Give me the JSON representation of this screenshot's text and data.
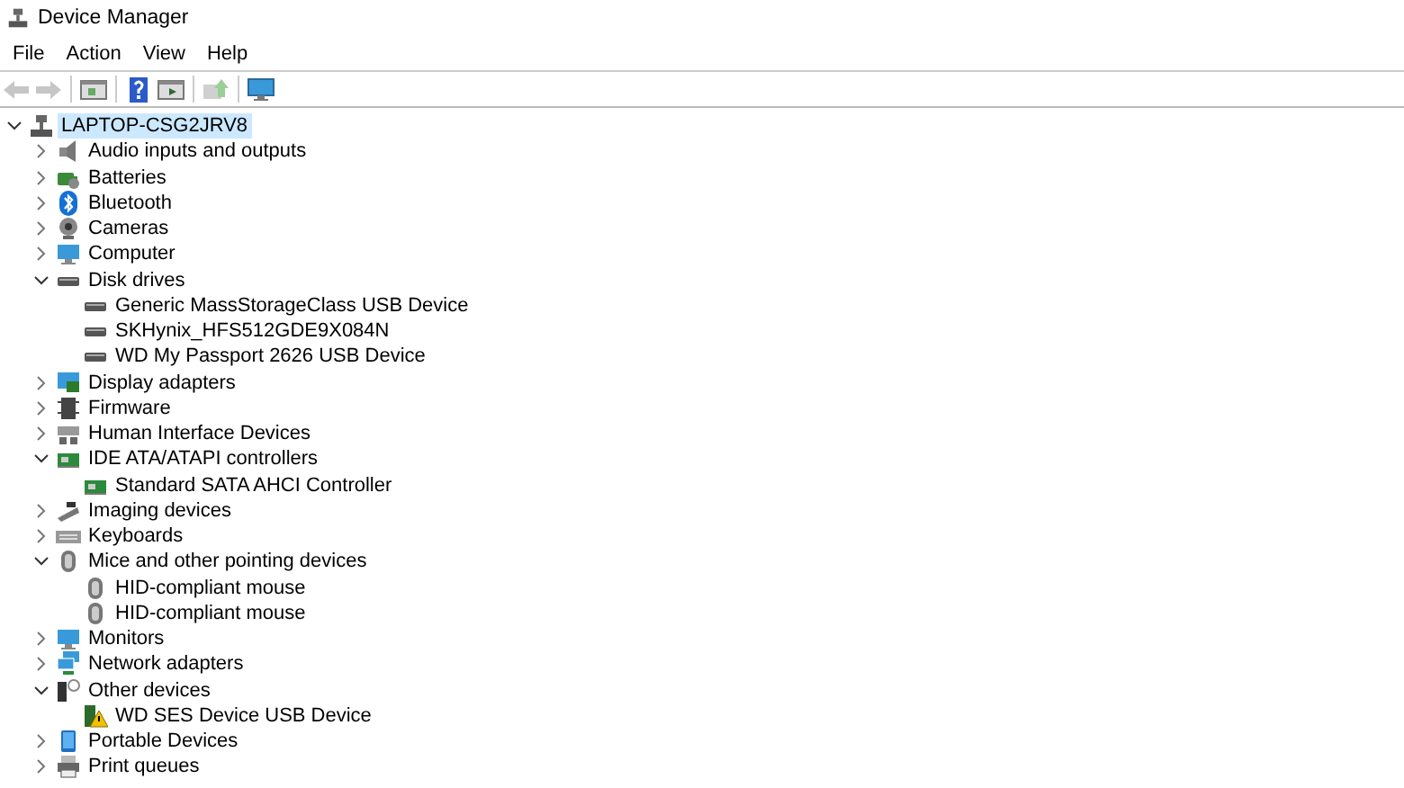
{
  "window": {
    "title": "Device Manager"
  },
  "menu": [
    "File",
    "Action",
    "View",
    "Help"
  ],
  "toolbar": [
    {
      "kind": "back",
      "disabled": true
    },
    {
      "kind": "forward",
      "disabled": true
    },
    {
      "kind": "separator"
    },
    {
      "kind": "pane"
    },
    {
      "kind": "separator"
    },
    {
      "kind": "help"
    },
    {
      "kind": "play-pane"
    },
    {
      "kind": "separator"
    },
    {
      "kind": "update",
      "disabled": true
    },
    {
      "kind": "separator"
    },
    {
      "kind": "scan"
    }
  ],
  "tree": {
    "label": "LAPTOP-CSG2JRV8",
    "kind": "computer",
    "expanded": true,
    "selected": true,
    "children": [
      {
        "label": "Audio inputs and outputs",
        "kind": "audio",
        "expanded": false,
        "selected": false
      },
      {
        "label": "Batteries",
        "kind": "battery",
        "expanded": false,
        "selected": false
      },
      {
        "label": "Bluetooth",
        "kind": "bluetooth",
        "expanded": false,
        "selected": false
      },
      {
        "label": "Cameras",
        "kind": "camera",
        "expanded": false,
        "selected": false
      },
      {
        "label": "Computer",
        "kind": "monitor",
        "expanded": false,
        "selected": false
      },
      {
        "label": "Disk drives",
        "kind": "disk",
        "expanded": true,
        "selected": false,
        "children": [
          {
            "label": "Generic MassStorageClass USB Device",
            "kind": "disk",
            "selected": false
          },
          {
            "label": "SKHynix_HFS512GDE9X084N",
            "kind": "disk",
            "selected": false
          },
          {
            "label": "WD My Passport 2626 USB Device",
            "kind": "disk",
            "selected": false
          }
        ]
      },
      {
        "label": "Display adapters",
        "kind": "display",
        "expanded": false,
        "selected": false
      },
      {
        "label": "Firmware",
        "kind": "firmware",
        "expanded": false,
        "selected": false
      },
      {
        "label": "Human Interface Devices",
        "kind": "hid",
        "expanded": false,
        "selected": false
      },
      {
        "label": "IDE ATA/ATAPI controllers",
        "kind": "controller",
        "expanded": true,
        "selected": false,
        "children": [
          {
            "label": "Standard SATA AHCI Controller",
            "kind": "controller",
            "selected": false
          }
        ]
      },
      {
        "label": "Imaging devices",
        "kind": "imaging",
        "expanded": false,
        "selected": false
      },
      {
        "label": "Keyboards",
        "kind": "keyboard",
        "expanded": false,
        "selected": false
      },
      {
        "label": "Mice and other pointing devices",
        "kind": "mouse",
        "expanded": true,
        "selected": false,
        "children": [
          {
            "label": "HID-compliant mouse",
            "kind": "mouse",
            "selected": false
          },
          {
            "label": "HID-compliant mouse",
            "kind": "mouse",
            "selected": false
          }
        ]
      },
      {
        "label": "Monitors",
        "kind": "monitor",
        "expanded": false,
        "selected": false
      },
      {
        "label": "Network adapters",
        "kind": "network",
        "expanded": false,
        "selected": false
      },
      {
        "label": "Other devices",
        "kind": "other",
        "expanded": true,
        "selected": false,
        "children": [
          {
            "label": "WD SES Device USB Device",
            "kind": "warning",
            "selected": false
          }
        ]
      },
      {
        "label": "Portable Devices",
        "kind": "portable",
        "expanded": false,
        "selected": false
      },
      {
        "label": "Print queues",
        "kind": "printer",
        "expanded": false,
        "selected": false
      }
    ]
  }
}
